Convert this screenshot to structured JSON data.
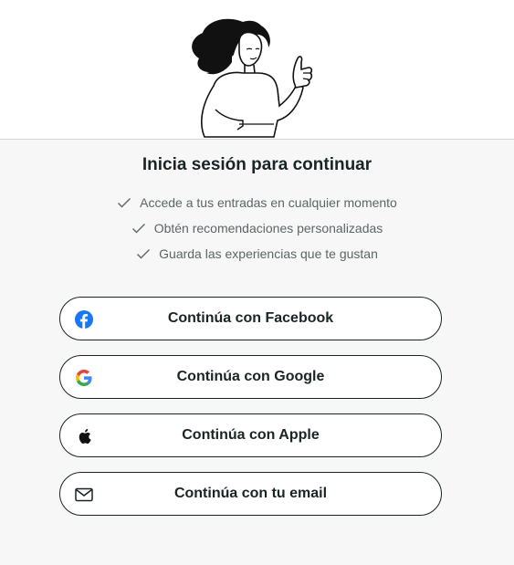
{
  "title": "Inicia sesión para continuar",
  "benefits": [
    {
      "text": "Accede a tus entradas en cualquier momento",
      "icon": "check-icon"
    },
    {
      "text": "Obtén recomendaciones personalizadas",
      "icon": "check-icon"
    },
    {
      "text": "Guarda las experiencias que te gustan",
      "icon": "check-icon"
    }
  ],
  "buttons": {
    "facebook": {
      "label": "Continúa con Facebook",
      "icon": "facebook-icon",
      "color": "#1877f2"
    },
    "google": {
      "label": "Continúa con Google",
      "icon": "google-icon"
    },
    "apple": {
      "label": "Continúa con Apple",
      "icon": "apple-icon"
    },
    "email": {
      "label": "Continúa con tu email",
      "icon": "mail-icon"
    }
  },
  "colors": {
    "text": "#1a2426",
    "muted": "#5d6566",
    "background": "#f7f7f7",
    "hero": "#ffffff"
  }
}
